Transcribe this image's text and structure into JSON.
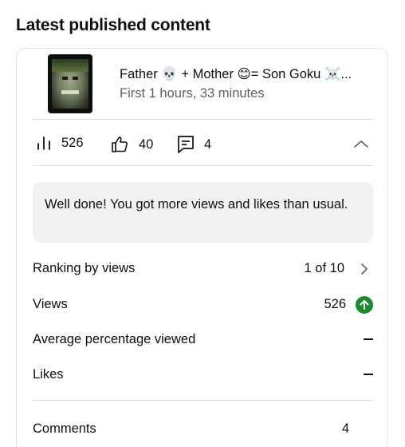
{
  "section": {
    "title": "Latest published content"
  },
  "video": {
    "title": "Father 💀 + Mother 😊= Son Goku ☠️...",
    "meta": "First 1 hours, 33 minutes"
  },
  "stats": {
    "views": "526",
    "likes": "40",
    "comments": "4"
  },
  "banner": {
    "message": "Well done! You got more views and likes than usual."
  },
  "metrics": [
    {
      "label": "Ranking by views",
      "value": "1 of 10"
    },
    {
      "label": "Views",
      "value": "526"
    },
    {
      "label": "Average percentage viewed",
      "value": "–"
    },
    {
      "label": "Likes",
      "value": "–"
    },
    {
      "label": "Comments",
      "value": "4"
    }
  ],
  "colors": {
    "trend_up": "#1a8c30",
    "banner_bg": "#f2f2f2",
    "meta_text": "#606060"
  }
}
